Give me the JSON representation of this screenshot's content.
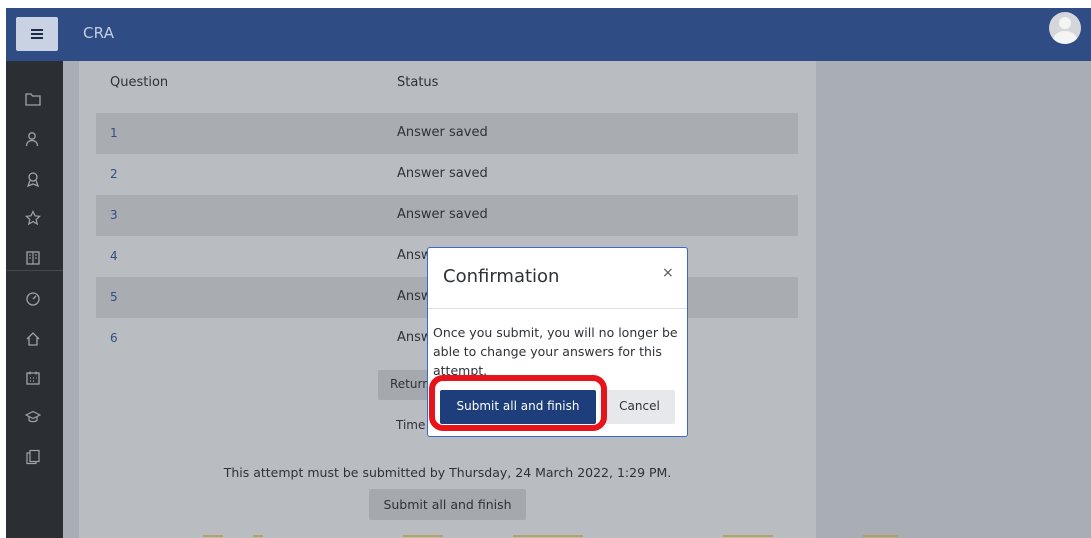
{
  "navbar": {
    "brand": "CRA",
    "menu_icon": "hamburger-icon",
    "avatar_icon": "user-avatar-icon"
  },
  "drawer": {
    "items": [
      {
        "icon": "folder-icon",
        "glyph": "▭"
      },
      {
        "icon": "participants-icon",
        "glyph": "♙"
      },
      {
        "icon": "badges-icon",
        "glyph": "♢"
      },
      {
        "icon": "star-icon",
        "glyph": "☆"
      },
      {
        "icon": "book-icon",
        "glyph": "▤"
      },
      {
        "icon": "dashboard-icon",
        "glyph": "◔"
      },
      {
        "icon": "home-icon",
        "glyph": "⌂"
      },
      {
        "icon": "calendar-icon",
        "glyph": "▦"
      },
      {
        "icon": "graduation-cap-icon",
        "glyph": "♧"
      },
      {
        "icon": "files-icon",
        "glyph": "❐"
      }
    ]
  },
  "summary": {
    "headers": {
      "question": "Question",
      "status": "Status"
    },
    "rows": [
      {
        "question": "1",
        "status": "Answer saved"
      },
      {
        "question": "2",
        "status": "Answer saved"
      },
      {
        "question": "3",
        "status": "Answer saved"
      },
      {
        "question": "4",
        "status": "Answer saved"
      },
      {
        "question": "5",
        "status": "Answer saved"
      },
      {
        "question": "6",
        "status": "Answer saved"
      }
    ],
    "return_button": "Return to attempt",
    "time_text": "Time left",
    "deadline": "This attempt must be submitted by Thursday, 24 March 2022, 1:29 PM.",
    "submit_button": "Submit all and finish"
  },
  "modal": {
    "title": "Confirmation",
    "close_glyph": "×",
    "body": "Once you submit, you will no longer be able to change your answers for this attempt.",
    "submit_label": "Submit all and finish",
    "cancel_label": "Cancel"
  },
  "colors": {
    "navbar": "#2f4d84",
    "drawer": "#2b2e33",
    "primary_button": "#1d3e7a",
    "highlight": "#e8141b"
  }
}
